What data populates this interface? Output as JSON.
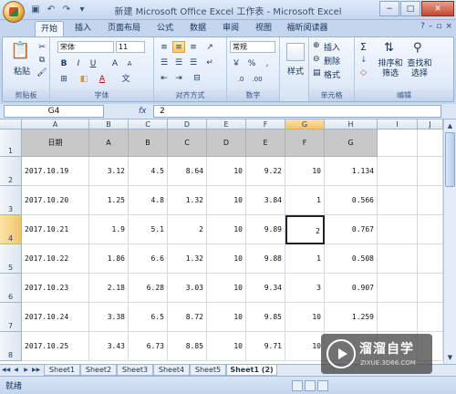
{
  "window": {
    "title": "新建 Microsoft Office Excel 工作表 - Microsoft Excel",
    "controls": [
      "−",
      "□",
      "✕"
    ]
  },
  "quick_access": [
    "save-icon",
    "undo-icon",
    "redo-icon",
    "dropdown-icon"
  ],
  "tabs": [
    "开始",
    "插入",
    "页面布局",
    "公式",
    "数据",
    "审阅",
    "视图",
    "福昕阅读器"
  ],
  "active_tab": "开始",
  "ribbon": {
    "clipboard": {
      "paste_label": "粘贴",
      "group_label": "剪贴板"
    },
    "font": {
      "font_name": "宋体",
      "font_size": "11",
      "bold": "B",
      "italic": "I",
      "underline": "U",
      "grow": "A",
      "shrink": "A",
      "font_color": "A",
      "group_label": "字体"
    },
    "alignment": {
      "group_label": "对齐方式"
    },
    "number": {
      "format": "常规",
      "currency": "￥",
      "percent": "%",
      "comma": ",",
      "group_label": "数字"
    },
    "styles": {
      "label": "样式"
    },
    "cells": {
      "insert": "插入",
      "delete": "删除",
      "format": "格式",
      "group_label": "单元格"
    },
    "editing": {
      "sigma": "Σ",
      "sort_filter": "排序和筛选",
      "find_select": "查找和选择",
      "group_label": "编辑"
    }
  },
  "formula_bar": {
    "name_box": "G4",
    "fx": "fx",
    "value": "2"
  },
  "sheet": {
    "columns": [
      "A",
      "B",
      "C",
      "D",
      "E",
      "F",
      "G",
      "H",
      "I",
      "J"
    ],
    "selected_column": "G",
    "selected_row": "4",
    "row_numbers": [
      "1",
      "2",
      "3",
      "4",
      "5",
      "6",
      "7",
      "8"
    ],
    "header_row": [
      "日期",
      "A",
      "B",
      "C",
      "D",
      "E",
      "F",
      "G"
    ],
    "rows": [
      [
        "2017.10.19",
        "3.12",
        "4.5",
        "8.64",
        "10",
        "9.22",
        "10",
        "1.134"
      ],
      [
        "2017.10.20",
        "1.25",
        "4.8",
        "1.32",
        "10",
        "3.84",
        "1",
        "0.566"
      ],
      [
        "2017.10.21",
        "1.9",
        "5.1",
        "2",
        "10",
        "9.89",
        "2",
        "0.767"
      ],
      [
        "2017.10.22",
        "1.86",
        "6.6",
        "1.32",
        "10",
        "9.88",
        "1",
        "0.508"
      ],
      [
        "2017.10.23",
        "2.18",
        "6.28",
        "3.03",
        "10",
        "9.34",
        "3",
        "0.907"
      ],
      [
        "2017.10.24",
        "3.38",
        "6.5",
        "8.72",
        "10",
        "9.85",
        "10",
        "1.259"
      ],
      [
        "2017.10.25",
        "3.43",
        "6.73",
        "8.85",
        "10",
        "9.71",
        "10",
        ""
      ]
    ]
  },
  "sheet_tabs": [
    "Sheet1",
    "Sheet2",
    "Sheet3",
    "Sheet4",
    "Sheet5",
    "Sheet1 (2)"
  ],
  "active_sheet": "Sheet1 (2)",
  "status": {
    "text": "就绪"
  },
  "watermark": {
    "title": "溜溜自学",
    "subtitle": "ZIXUE.3D66.COM"
  }
}
